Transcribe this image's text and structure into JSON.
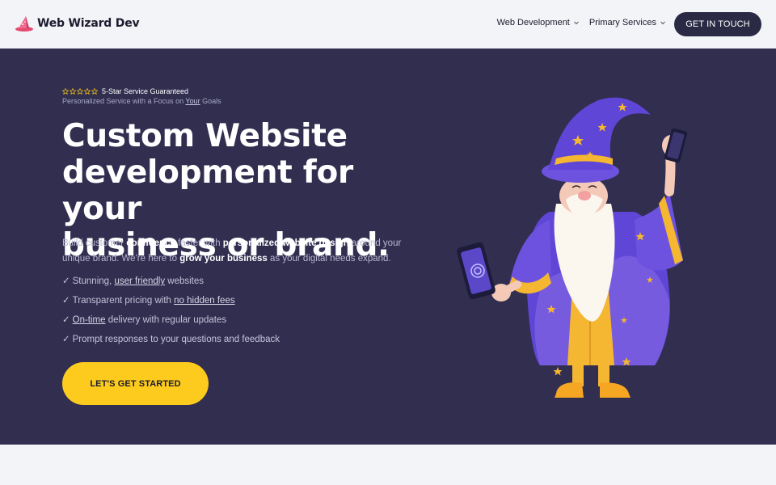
{
  "nav": {
    "brand": "Web Wizard Dev",
    "menu": [
      {
        "label": "Web Development"
      },
      {
        "label": "Primary Services"
      }
    ],
    "cta": "GET IN TOUCH"
  },
  "hero": {
    "rating": {
      "stars": 5,
      "text": "5-Star Service Guaranteed"
    },
    "subtag": {
      "before": "Personalized Service with a Focus on ",
      "underlined": "Your",
      "after": " Goals"
    },
    "headline": [
      "Custom Website",
      "development for your",
      "business or brand."
    ],
    "description": {
      "p1": "Build customer ",
      "b1": "confidence",
      "p2": " faster with ",
      "b2": "personalized website design",
      "p3": " around your unique brand. We're here to ",
      "b3": "grow your business",
      "p4": " as your digital needs expand."
    },
    "checklist": [
      {
        "mark": "✓",
        "before": "Stunning, ",
        "underlined": "user friendly",
        "after": " websites"
      },
      {
        "mark": "✓",
        "before": "Transparent pricing with ",
        "underlined": "no hidden fees",
        "after": ""
      },
      {
        "mark": "✓",
        "before": "",
        "underlined": "On-time",
        "after": " delivery with regular updates"
      },
      {
        "mark": "✓",
        "before": "Prompt responses to your questions and feedback",
        "underlined": "",
        "after": ""
      }
    ],
    "cta": "LET'S GET STARTED",
    "illustration": "wizard-holding-phones"
  },
  "colors": {
    "hero_bg": "#312e50",
    "nav_bg": "#f3f4f8",
    "accent_yellow": "#fccb1d",
    "dark_button": "#2a2a45"
  }
}
